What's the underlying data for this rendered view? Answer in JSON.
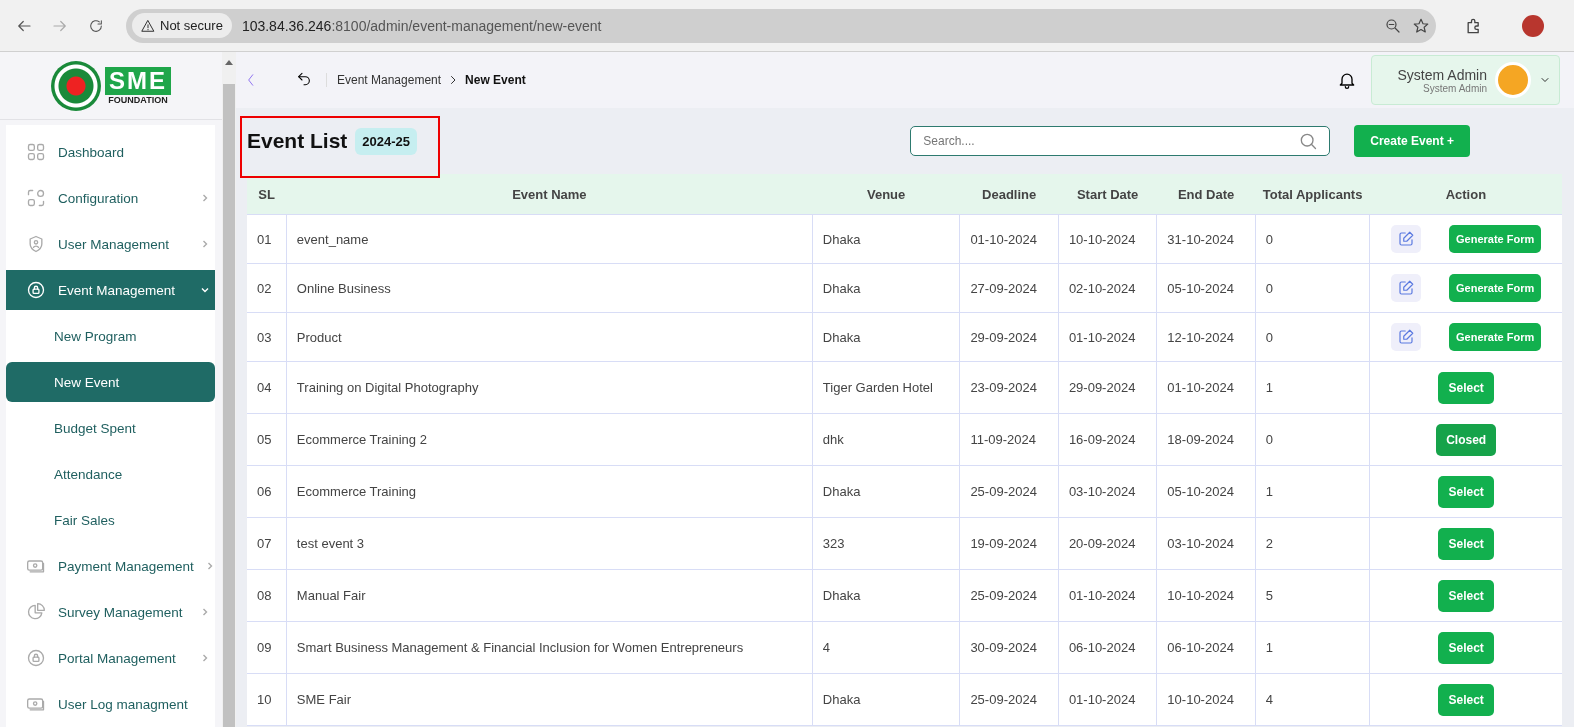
{
  "browser": {
    "security": "Not secure",
    "url_host": "103.84.36.246",
    "url_path": ":8100/admin/event-management/new-event"
  },
  "logo": {
    "name": "SME",
    "subtitle": "FOUNDATION"
  },
  "sidebar": {
    "items": [
      {
        "label": "Dashboard",
        "selected": false
      },
      {
        "label": "Configuration",
        "selected": false,
        "expanded": false
      },
      {
        "label": "User Management",
        "selected": false,
        "expanded": false
      },
      {
        "label": "Event Management",
        "selected": true,
        "expanded": true,
        "children": [
          {
            "label": "New Program",
            "selected": false
          },
          {
            "label": "New Event",
            "selected": true
          },
          {
            "label": "Budget Spent",
            "selected": false
          },
          {
            "label": "Attendance",
            "selected": false
          },
          {
            "label": "Fair Sales",
            "selected": false
          }
        ]
      },
      {
        "label": "Payment Management",
        "selected": false,
        "expanded": false
      },
      {
        "label": "Survey Management",
        "selected": false,
        "expanded": false
      },
      {
        "label": "Portal Management",
        "selected": false,
        "expanded": false
      },
      {
        "label": "User Log managment",
        "selected": false
      }
    ]
  },
  "breadcrumb": [
    "Event Management",
    "New Event"
  ],
  "user": {
    "name": "System Admin",
    "role": "System Admin"
  },
  "page": {
    "title": "Event List",
    "year": "2024-25",
    "search_placeholder": "Search....",
    "create_button": "Create Event +"
  },
  "table": {
    "columns": [
      "SL",
      "Event Name",
      "Venue",
      "Deadline",
      "Start Date",
      "End Date",
      "Total Applicants",
      "Action"
    ],
    "rows": [
      {
        "sl": "01",
        "name": "event_name",
        "venue": "Dhaka",
        "deadline": "01-10-2024",
        "start": "10-10-2024",
        "end": "31-10-2024",
        "applicants": "0",
        "action": {
          "kind": "generate",
          "label": "Generate Form"
        }
      },
      {
        "sl": "02",
        "name": "Online Business",
        "venue": "Dhaka",
        "deadline": "27-09-2024",
        "start": "02-10-2024",
        "end": "05-10-2024",
        "applicants": "0",
        "action": {
          "kind": "generate",
          "label": "Generate Form"
        }
      },
      {
        "sl": "03",
        "name": "Product",
        "venue": "Dhaka",
        "deadline": "29-09-2024",
        "start": "01-10-2024",
        "end": "12-10-2024",
        "applicants": "0",
        "action": {
          "kind": "generate",
          "label": "Generate Form"
        }
      },
      {
        "sl": "04",
        "name": "Training on Digital Photography",
        "venue": "Tiger Garden Hotel",
        "deadline": "23-09-2024",
        "start": "29-09-2024",
        "end": "01-10-2024",
        "applicants": "1",
        "action": {
          "kind": "select",
          "label": "Select"
        }
      },
      {
        "sl": "05",
        "name": "Ecommerce Training 2",
        "venue": "dhk",
        "deadline": "11-09-2024",
        "start": "16-09-2024",
        "end": "18-09-2024",
        "applicants": "0",
        "action": {
          "kind": "closed",
          "label": "Closed"
        }
      },
      {
        "sl": "06",
        "name": "Ecommerce Training",
        "venue": "Dhaka",
        "deadline": "25-09-2024",
        "start": "03-10-2024",
        "end": "05-10-2024",
        "applicants": "1",
        "action": {
          "kind": "select",
          "label": "Select"
        }
      },
      {
        "sl": "07",
        "name": "test event 3",
        "venue": "323",
        "deadline": "19-09-2024",
        "start": "20-09-2024",
        "end": "03-10-2024",
        "applicants": "2",
        "action": {
          "kind": "select",
          "label": "Select"
        }
      },
      {
        "sl": "08",
        "name": "Manual Fair",
        "venue": "Dhaka",
        "deadline": "25-09-2024",
        "start": "01-10-2024",
        "end": "10-10-2024",
        "applicants": "5",
        "action": {
          "kind": "select",
          "label": "Select"
        }
      },
      {
        "sl": "09",
        "name": "Smart Business Management & Financial Inclusion for Women Entrepreneurs",
        "venue": "4",
        "deadline": "30-09-2024",
        "start": "06-10-2024",
        "end": "06-10-2024",
        "applicants": "1",
        "action": {
          "kind": "select",
          "label": "Select"
        }
      },
      {
        "sl": "10",
        "name": "SME Fair",
        "venue": "Dhaka",
        "deadline": "25-09-2024",
        "start": "01-10-2024",
        "end": "10-10-2024",
        "applicants": "4",
        "action": {
          "kind": "select",
          "label": "Select"
        }
      }
    ]
  }
}
